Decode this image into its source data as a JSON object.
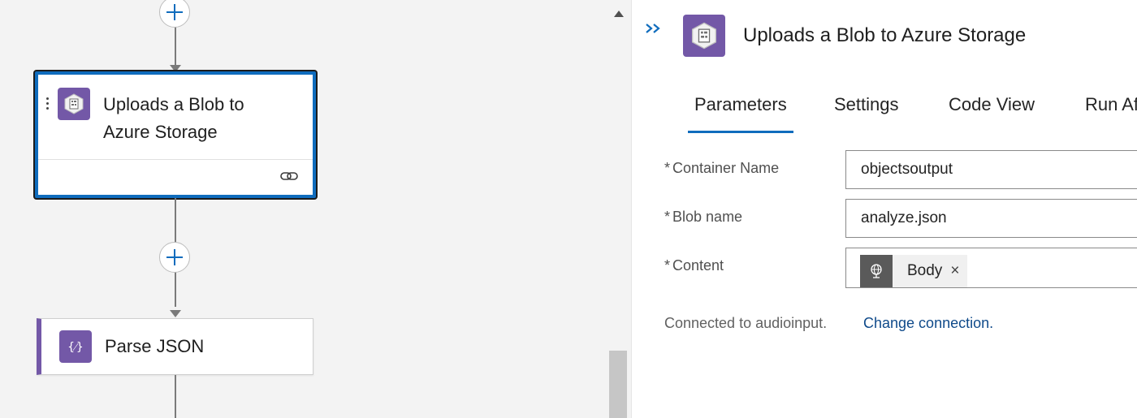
{
  "canvas": {
    "selected_action": {
      "title_line1": "Uploads a Blob to",
      "title_line2": "Azure Storage",
      "icon": "storage-blob-icon",
      "footer_icon": "link-icon"
    },
    "next_action": {
      "title": "Parse JSON",
      "icon": "curly-braces-icon"
    },
    "add_button_icon": "plus-icon",
    "accent_color": "#0f6cbd",
    "action_color": "#7358a7"
  },
  "panel": {
    "collapse_icon": "double-chevron-right-icon",
    "title": "Uploads a Blob to Azure Storage",
    "tabs": [
      {
        "label": "Parameters",
        "active": true
      },
      {
        "label": "Settings",
        "active": false
      },
      {
        "label": "Code View",
        "active": false
      },
      {
        "label": "Run After",
        "active": false
      }
    ],
    "params": [
      {
        "required": "*",
        "label": "Container Name",
        "value": "objectsoutput"
      },
      {
        "required": "*",
        "label": "Blob name",
        "value": "analyze.json"
      },
      {
        "required": "*",
        "label": "Content",
        "token": "Body",
        "token_icon": "globe-icon",
        "token_remove": "×"
      }
    ],
    "connection_text": "Connected to audioinput.",
    "change_connection": "Change connection."
  }
}
